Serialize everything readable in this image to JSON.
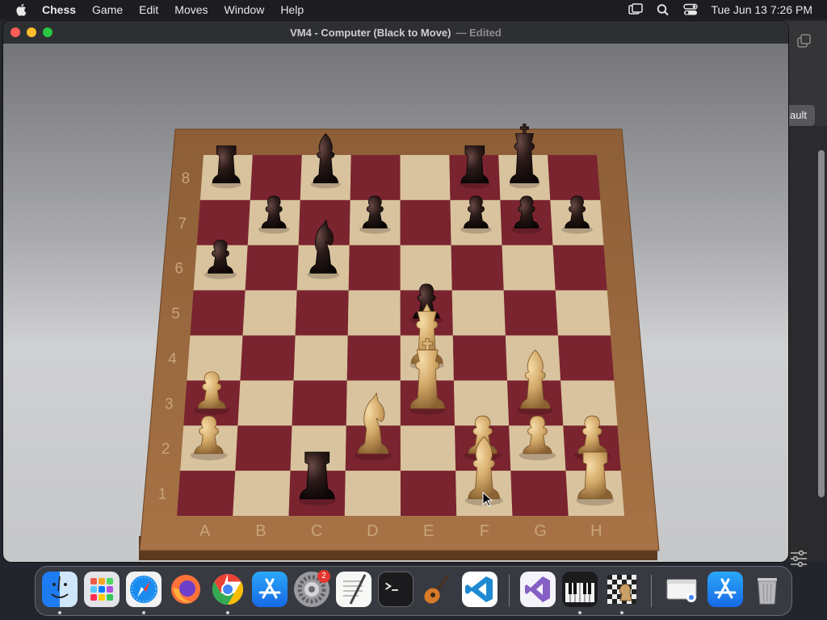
{
  "menubar": {
    "app_name": "Chess",
    "items": [
      "Game",
      "Edit",
      "Moves",
      "Window",
      "Help"
    ],
    "clock": "Tue Jun 13  7:26 PM"
  },
  "window": {
    "title": "VM4 - Computer   (Black to Move)",
    "edited": "— Edited"
  },
  "background_window": {
    "button_partial_label": "ault"
  },
  "board": {
    "files": [
      "A",
      "B",
      "C",
      "D",
      "E",
      "F",
      "G",
      "H"
    ],
    "ranks": [
      "8",
      "7",
      "6",
      "5",
      "4",
      "3",
      "2",
      "1"
    ],
    "light_square_color": "#d9c39e",
    "dark_square_color": "#7a2430",
    "frame_color": "#9a6a3e",
    "pieces": [
      {
        "square": "a8",
        "type": "rook",
        "color": "black"
      },
      {
        "square": "c8",
        "type": "bishop",
        "color": "black"
      },
      {
        "square": "f8",
        "type": "rook",
        "color": "black"
      },
      {
        "square": "g8",
        "type": "king",
        "color": "black"
      },
      {
        "square": "b7",
        "type": "pawn",
        "color": "black"
      },
      {
        "square": "d7",
        "type": "pawn",
        "color": "black"
      },
      {
        "square": "f7",
        "type": "pawn",
        "color": "black"
      },
      {
        "square": "g7",
        "type": "pawn",
        "color": "black"
      },
      {
        "square": "h7",
        "type": "pawn",
        "color": "black"
      },
      {
        "square": "a6",
        "type": "pawn",
        "color": "black"
      },
      {
        "square": "c6",
        "type": "knight",
        "color": "black"
      },
      {
        "square": "e5",
        "type": "pawn",
        "color": "black"
      },
      {
        "square": "c1",
        "type": "rook",
        "color": "black"
      },
      {
        "square": "e4",
        "type": "queen",
        "color": "white"
      },
      {
        "square": "e3",
        "type": "king",
        "color": "white"
      },
      {
        "square": "a3",
        "type": "pawn",
        "color": "white"
      },
      {
        "square": "g3",
        "type": "bishop",
        "color": "white"
      },
      {
        "square": "a2",
        "type": "pawn",
        "color": "white"
      },
      {
        "square": "d2",
        "type": "knight",
        "color": "white"
      },
      {
        "square": "f2",
        "type": "pawn",
        "color": "white"
      },
      {
        "square": "g2",
        "type": "pawn",
        "color": "white"
      },
      {
        "square": "h2",
        "type": "pawn",
        "color": "white"
      },
      {
        "square": "f1",
        "type": "bishop",
        "color": "white"
      },
      {
        "square": "h1",
        "type": "rook",
        "color": "white"
      }
    ]
  },
  "dock": {
    "apps": [
      {
        "name": "Finder",
        "icon": "finder-icon",
        "running": true
      },
      {
        "name": "Launchpad",
        "icon": "launchpad-icon",
        "running": false
      },
      {
        "name": "Safari",
        "icon": "safari-icon",
        "running": true
      },
      {
        "name": "Firefox",
        "icon": "firefox-icon",
        "running": false
      },
      {
        "name": "Chrome",
        "icon": "chrome-icon",
        "running": true
      },
      {
        "name": "App Store",
        "icon": "app-store-icon",
        "running": false
      },
      {
        "name": "System Settings",
        "icon": "settings-icon",
        "running": false,
        "badge": "2"
      },
      {
        "name": "TextEdit",
        "icon": "textedit-icon",
        "running": false
      },
      {
        "name": "Terminal",
        "icon": "terminal-icon",
        "running": false
      },
      {
        "name": "GarageBand",
        "icon": "guitar-icon",
        "running": false
      },
      {
        "name": "VS Code",
        "icon": "vscode-icon",
        "running": false
      },
      {
        "name": "Visual Studio",
        "icon": "visual-studio-icon",
        "running": false
      },
      {
        "name": "Piano",
        "icon": "piano-icon",
        "running": true
      },
      {
        "name": "Chess",
        "icon": "chess-icon",
        "running": true
      },
      {
        "name": "Downloads",
        "icon": "downloads-stack-icon",
        "running": false
      },
      {
        "name": "App Store Installer",
        "icon": "app-store-icon",
        "running": false
      },
      {
        "name": "Trash",
        "icon": "trash-icon",
        "running": false
      }
    ]
  }
}
